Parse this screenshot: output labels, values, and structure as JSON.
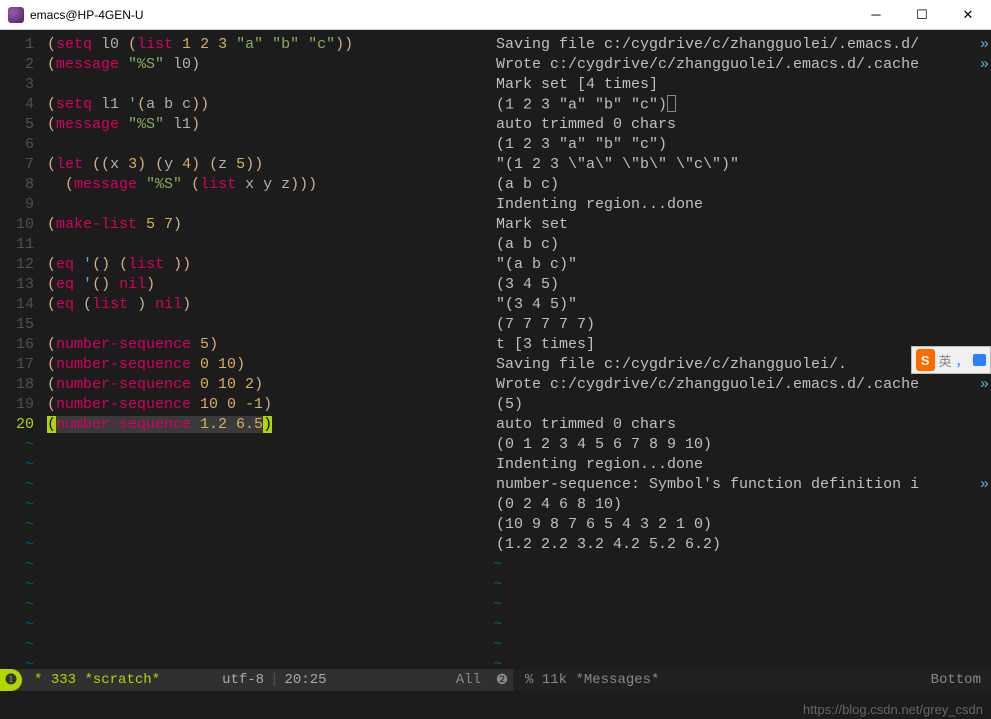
{
  "window": {
    "title": "emacs@HP-4GEN-U"
  },
  "left_pane": {
    "lines": [
      {
        "n": "1",
        "seg": [
          [
            "p",
            "("
          ],
          [
            "k",
            "setq"
          ],
          [
            "v",
            " l0 "
          ],
          [
            "p",
            "("
          ],
          [
            "k",
            "list"
          ],
          [
            "n",
            " 1 2 3"
          ],
          [
            "s",
            " \"a\" \"b\" \"c\""
          ],
          [
            "p",
            "))"
          ]
        ]
      },
      {
        "n": "2",
        "seg": [
          [
            "p",
            "("
          ],
          [
            "k",
            "message"
          ],
          [
            "s",
            " \"%S\""
          ],
          [
            "v",
            " l0"
          ],
          [
            "p",
            ")"
          ]
        ]
      },
      {
        "n": "3",
        "seg": []
      },
      {
        "n": "4",
        "seg": [
          [
            "p",
            "("
          ],
          [
            "k",
            "setq"
          ],
          [
            "v",
            " l1 "
          ],
          [
            "q",
            "'"
          ],
          [
            "p",
            "("
          ],
          [
            "v",
            "a b c"
          ],
          [
            "p",
            "))"
          ]
        ]
      },
      {
        "n": "5",
        "seg": [
          [
            "p",
            "("
          ],
          [
            "k",
            "message"
          ],
          [
            "s",
            " \"%S\""
          ],
          [
            "v",
            " l1"
          ],
          [
            "p",
            ")"
          ]
        ]
      },
      {
        "n": "6",
        "seg": []
      },
      {
        "n": "7",
        "seg": [
          [
            "p",
            "("
          ],
          [
            "k",
            "let"
          ],
          [
            "v",
            " "
          ],
          [
            "p",
            "(("
          ],
          [
            "v",
            "x "
          ],
          [
            "n",
            "3"
          ],
          [
            "p",
            ") ("
          ],
          [
            "v",
            "y "
          ],
          [
            "n",
            "4"
          ],
          [
            "p",
            ") ("
          ],
          [
            "v",
            "z "
          ],
          [
            "n",
            "5"
          ],
          [
            "p",
            "))"
          ]
        ]
      },
      {
        "n": "8",
        "seg": [
          [
            "v",
            "  "
          ],
          [
            "p",
            "("
          ],
          [
            "k",
            "message"
          ],
          [
            "s",
            " \"%S\""
          ],
          [
            "v",
            " "
          ],
          [
            "p",
            "("
          ],
          [
            "k",
            "list"
          ],
          [
            "v",
            " x y z"
          ],
          [
            "p",
            ")))"
          ]
        ]
      },
      {
        "n": "9",
        "seg": []
      },
      {
        "n": "10",
        "seg": [
          [
            "p",
            "("
          ],
          [
            "k",
            "make-list"
          ],
          [
            "n",
            " 5 7"
          ],
          [
            "p",
            ")"
          ]
        ]
      },
      {
        "n": "11",
        "seg": []
      },
      {
        "n": "12",
        "seg": [
          [
            "p",
            "("
          ],
          [
            "k",
            "eq"
          ],
          [
            "v",
            " "
          ],
          [
            "q",
            "'"
          ],
          [
            "p",
            "()"
          ],
          [
            "v",
            " "
          ],
          [
            "p",
            "("
          ],
          [
            "k",
            "list"
          ],
          [
            "v",
            " "
          ],
          [
            "p",
            "))"
          ]
        ]
      },
      {
        "n": "13",
        "seg": [
          [
            "p",
            "("
          ],
          [
            "k",
            "eq"
          ],
          [
            "v",
            " "
          ],
          [
            "q",
            "'"
          ],
          [
            "p",
            "()"
          ],
          [
            "v",
            " "
          ],
          [
            "k",
            "nil"
          ],
          [
            "p",
            ")"
          ]
        ]
      },
      {
        "n": "14",
        "seg": [
          [
            "p",
            "("
          ],
          [
            "k",
            "eq"
          ],
          [
            "v",
            " "
          ],
          [
            "p",
            "("
          ],
          [
            "k",
            "list"
          ],
          [
            "v",
            " "
          ],
          [
            "p",
            ")"
          ],
          [
            "v",
            " "
          ],
          [
            "k",
            "nil"
          ],
          [
            "p",
            ")"
          ]
        ]
      },
      {
        "n": "15",
        "seg": []
      },
      {
        "n": "16",
        "seg": [
          [
            "p",
            "("
          ],
          [
            "k",
            "number-sequence"
          ],
          [
            "n",
            " 5"
          ],
          [
            "p",
            ")"
          ]
        ]
      },
      {
        "n": "17",
        "seg": [
          [
            "p",
            "("
          ],
          [
            "k",
            "number-sequence"
          ],
          [
            "n",
            " 0 10"
          ],
          [
            "p",
            ")"
          ]
        ]
      },
      {
        "n": "18",
        "seg": [
          [
            "p",
            "("
          ],
          [
            "k",
            "number-sequence"
          ],
          [
            "n",
            " 0 10 2"
          ],
          [
            "p",
            ")"
          ]
        ]
      },
      {
        "n": "19",
        "seg": [
          [
            "p",
            "("
          ],
          [
            "k",
            "number-sequence"
          ],
          [
            "n",
            " 10 0 -1"
          ],
          [
            "p",
            ")"
          ]
        ]
      },
      {
        "n": "20",
        "hl": true,
        "seg": [
          [
            "m",
            "("
          ],
          [
            "k",
            "number-sequence"
          ],
          [
            "n",
            " 1.2 6.5"
          ],
          [
            "m",
            ")"
          ]
        ]
      }
    ]
  },
  "right_pane": {
    "lines": [
      "Saving file c:/cygdrive/c/zhangguolei/.emacs.d/",
      "Wrote c:/cygdrive/c/zhangguolei/.emacs.d/.cache",
      "Mark set [4 times]",
      "(1 2 3 \"a\" \"b\" \"c\")□",
      "auto trimmed 0 chars",
      "(1 2 3 \"a\" \"b\" \"c\")",
      "\"(1 2 3 \\\"a\\\" \\\"b\\\" \\\"c\\\")\"",
      "(a b c)",
      "Indenting region...done",
      "Mark set",
      "(a b c)",
      "\"(a b c)\"",
      "(3 4 5)",
      "\"(3 4 5)\"",
      "(7 7 7 7 7)",
      "t [3 times]",
      "Saving file c:/cygdrive/c/zhangguolei/.",
      "Wrote c:/cygdrive/c/zhangguolei/.emacs.d/.cache",
      "(5)",
      "auto trimmed 0 chars",
      "(0 1 2 3 4 5 6 7 8 9 10)",
      "Indenting region...done",
      "number-sequence: Symbol's function definition i",
      "(0 2 4 6 8 10)",
      "(10 9 8 7 6 5 4 3 2 1 0)",
      "(1.2 2.2 3.2 4.2 5.2 6.2)"
    ],
    "trunc_lines": [
      0,
      1,
      16,
      17,
      22
    ]
  },
  "modeline_left": {
    "modified": "*",
    "size": "333",
    "buffer": "*scratch*",
    "encoding": "utf-8",
    "position": "20:25",
    "scroll": "All"
  },
  "modeline_right": {
    "modified": "%",
    "size": "11k",
    "buffer": "*Messages*",
    "scroll": "Bottom"
  },
  "ime": {
    "lang": "英"
  },
  "watermark": "https://blog.csdn.net/grey_csdn"
}
